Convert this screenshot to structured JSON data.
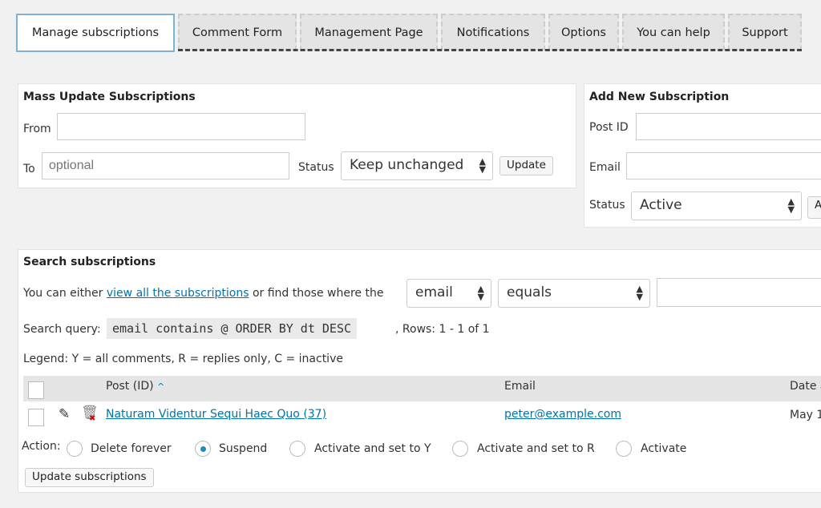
{
  "tabs": [
    {
      "label": "Manage subscriptions",
      "active": true
    },
    {
      "label": "Comment Form"
    },
    {
      "label": "Management Page"
    },
    {
      "label": "Notifications"
    },
    {
      "label": "Options"
    },
    {
      "label": "You can help"
    },
    {
      "label": "Support"
    }
  ],
  "mass_update": {
    "title": "Mass Update Subscriptions",
    "from_label": "From",
    "from_value": "",
    "to_label": "To",
    "to_placeholder": "optional",
    "status_label": "Status",
    "status_value": "Keep unchanged",
    "update_button": "Update"
  },
  "add_new": {
    "title": "Add New Subscription",
    "post_id_label": "Post ID",
    "email_label": "Email",
    "status_label": "Status",
    "status_value": "Active",
    "add_button": "A"
  },
  "search": {
    "title": "Search subscriptions",
    "intro_prefix": "You can either",
    "view_all_link": "view all the subscriptions",
    "intro_suffix": "or find those where the",
    "field_value": "email",
    "operator_value": "equals",
    "search_value": "",
    "query_label": "Search query:",
    "query": "email contains @ ORDER BY dt DESC",
    "rows": ", Rows: 1 - 1 of 1",
    "legend": "Legend: Y = all comments, R = replies only, C = inactive"
  },
  "table": {
    "columns": [
      "Post (ID)",
      "Email",
      "Date a"
    ],
    "sort_indicator": "^",
    "rows": [
      {
        "post": "Naturam Videntur Sequi Haec Quo (37)",
        "email": "peter@example.com",
        "date": "May 1"
      }
    ]
  },
  "actions": {
    "label": "Action:",
    "options": [
      {
        "label": "Delete forever",
        "selected": false
      },
      {
        "label": "Suspend",
        "selected": true
      },
      {
        "label": "Activate and set to Y",
        "selected": false
      },
      {
        "label": "Activate and set to R",
        "selected": false
      },
      {
        "label": "Activate",
        "selected": false
      }
    ],
    "submit": "Update subscriptions"
  }
}
